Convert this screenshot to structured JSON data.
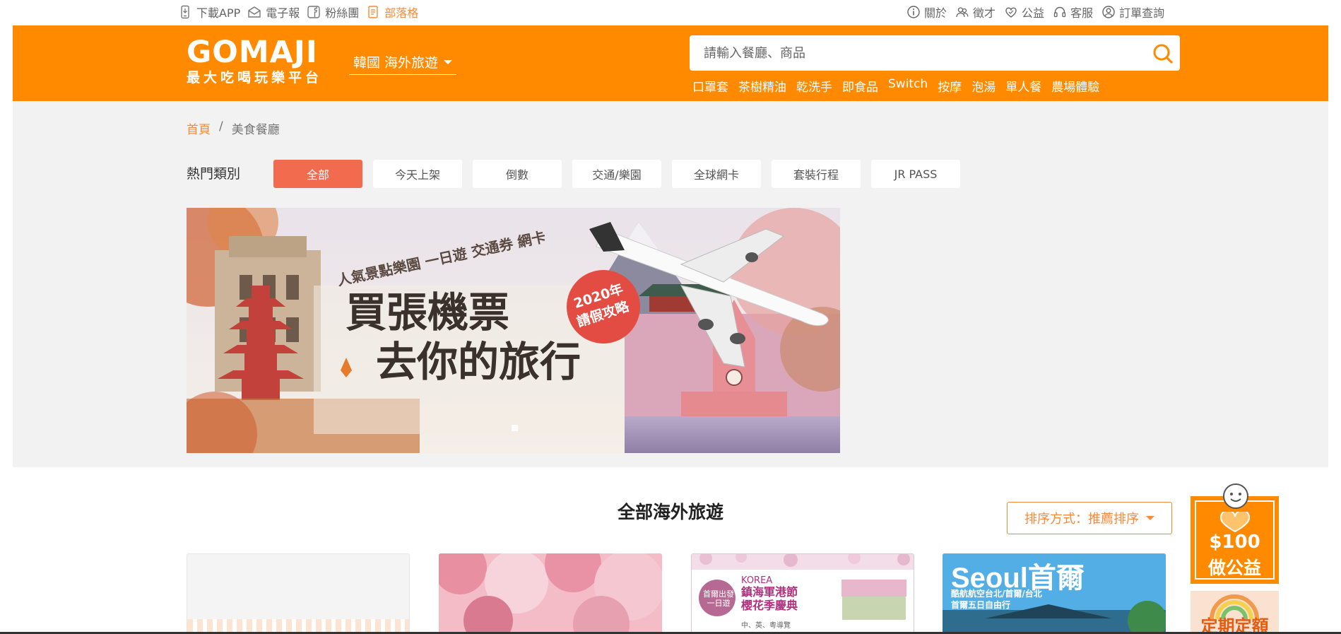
{
  "topbar": {
    "left": [
      {
        "label": "下載APP",
        "icon": "phone-icon"
      },
      {
        "label": "電子報",
        "icon": "mail-icon"
      },
      {
        "label": "粉絲團",
        "icon": "facebook-icon"
      },
      {
        "label": "部落格",
        "icon": "blog-icon"
      }
    ],
    "right": [
      {
        "label": "關於",
        "icon": "info-icon"
      },
      {
        "label": "徵才",
        "icon": "people-icon"
      },
      {
        "label": "公益",
        "icon": "heart-icon"
      },
      {
        "label": "客服",
        "icon": "headset-icon"
      },
      {
        "label": "訂單查詢",
        "icon": "user-icon"
      }
    ]
  },
  "header": {
    "logo_word": "GOMAJI",
    "logo_slogan": "最大吃喝玩樂平台",
    "region": "韓國 海外旅遊",
    "search_placeholder": "請輸入餐廳、商品",
    "hot_keywords": [
      "口罩套",
      "茶樹精油",
      "乾洗手",
      "即食品",
      "Switch",
      "按摩",
      "泡湯",
      "單人餐",
      "農場體驗"
    ],
    "accent_color": "#ff8a00"
  },
  "breadcrumb": {
    "home": "首頁",
    "separator": "/",
    "current": "美食餐廳"
  },
  "categories": {
    "label": "熱門類別",
    "items": [
      "全部",
      "今天上架",
      "倒數",
      "交通/樂園",
      "全球網卡",
      "套裝行程",
      "JR PASS"
    ],
    "active_color": "#f26b4f"
  },
  "banner": {
    "tagline": "人氣景點樂園 一日遊 交通券 網卡",
    "line1": "買張機票",
    "line2": "去你的旅行",
    "badge_line1": "2020年",
    "badge_line2": "請假攻略"
  },
  "listing": {
    "title": "全部海外旅遊",
    "sort_label": "排序方式：推薦排序"
  },
  "cards": {
    "card3": {
      "korea": "KOREA",
      "title1": "鎮海軍港節",
      "title2": "櫻花季慶典",
      "badge": "首爾出發 一日遊",
      "lang": "中、英、粵導覽"
    },
    "card4": {
      "seoul": "Seoul首爾",
      "sub1": "酷航航空台北/首爾/台北",
      "sub2": "首爾五日自由行"
    }
  },
  "side_promos": {
    "promo1_price": "$100",
    "promo1_text": "做公益",
    "promo2_text": "定期定額"
  }
}
